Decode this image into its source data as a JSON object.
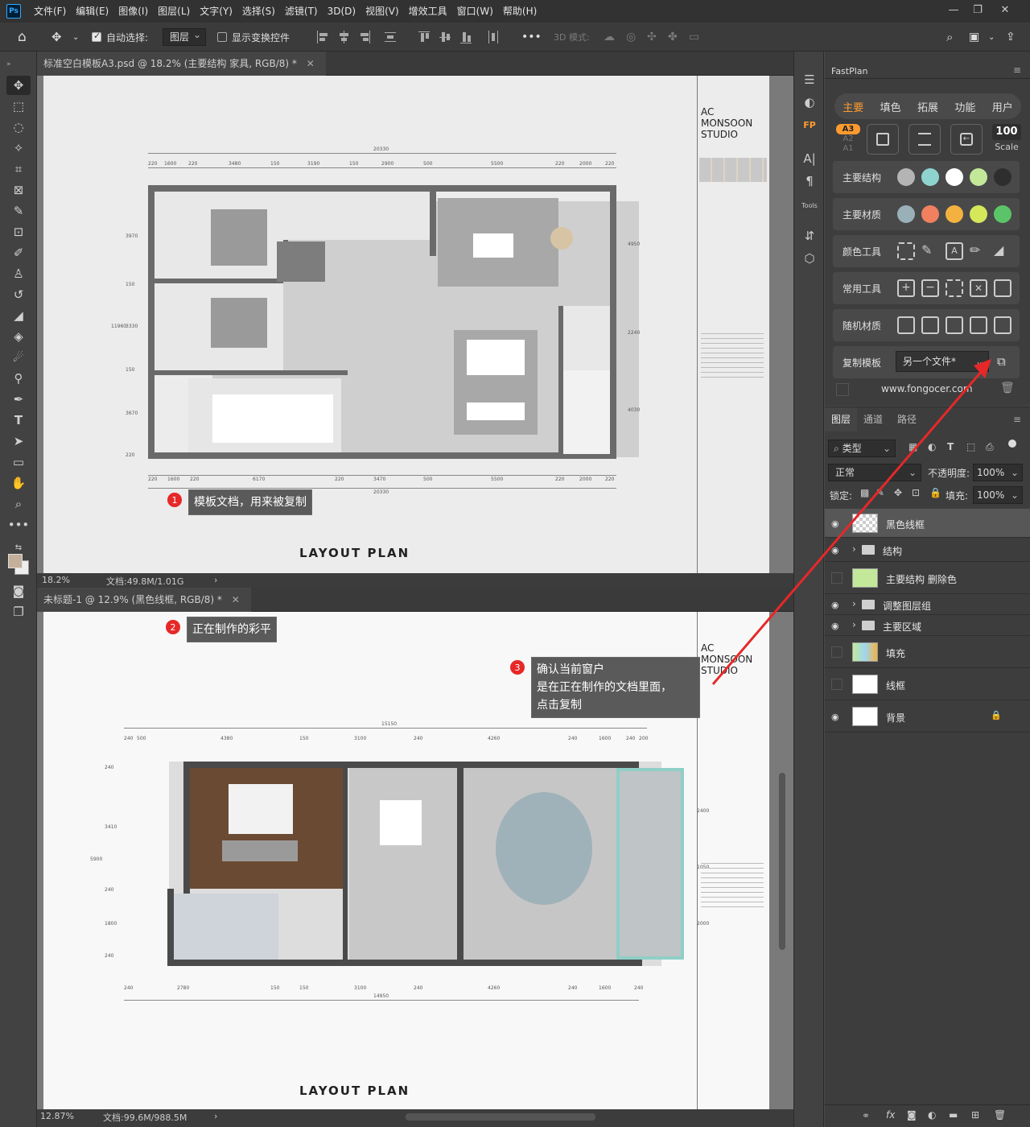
{
  "menubar": {
    "logo": "Ps",
    "items": [
      "文件(F)",
      "编辑(E)",
      "图像(I)",
      "图层(L)",
      "文字(Y)",
      "选择(S)",
      "滤镜(T)",
      "3D(D)",
      "视图(V)",
      "增效工具",
      "窗口(W)",
      "帮助(H)"
    ]
  },
  "options": {
    "auto_select_label": "自动选择:",
    "auto_select_value": "图层",
    "show_transform_label": "显示变换控件",
    "mode_3d_label": "3D 模式:",
    "more": "•••"
  },
  "doc1": {
    "tab_title": "标准空白模板A3.psd @ 18.2% (主要结构 家具, RGB/8) *",
    "zoom": "18.2%",
    "doc_size": "文档:49.8M/1.01G",
    "studio_name": [
      "AC",
      "MONSOON",
      "STUDIO"
    ],
    "layout_title": "LAYOUT PLAN",
    "dims_top_total": "20330",
    "dims_top": [
      "220",
      "1600",
      "220",
      "3480",
      "150",
      "3190",
      "150",
      "2900",
      "500",
      "5500",
      "220",
      "2000",
      "220"
    ],
    "dims_bottom": [
      "220",
      "1600",
      "220",
      "6170",
      "220",
      "3470",
      "500",
      "5500",
      "220",
      "2000",
      "220"
    ],
    "dims_bottom_total": "20330",
    "dims_left": [
      "3970",
      "150",
      "3330",
      "150",
      "3670",
      "220"
    ],
    "dims_left_total": "11960",
    "dims_right": [
      "4950",
      "2240",
      "4030"
    ]
  },
  "doc2": {
    "tab_title": "未标题-1 @ 12.9% (黑色线框, RGB/8) *",
    "zoom": "12.87%",
    "doc_size": "文档:99.6M/988.5M",
    "studio_name": [
      "AC",
      "MONSOON",
      "STUDIO"
    ],
    "layout_title": "LAYOUT PLAN",
    "dims_top_total": "15150",
    "dims_top": [
      "240",
      "500",
      "4380",
      "150",
      "3100",
      "240",
      "4260",
      "240",
      "1600",
      "240",
      "200"
    ],
    "dims_bottom": [
      "240",
      "2780",
      "150",
      "150",
      "3100",
      "240",
      "4260",
      "240",
      "1600",
      "240"
    ],
    "dims_bottom_total": "14950",
    "dims_left": [
      "240",
      "3410",
      "240",
      "1800",
      "240"
    ],
    "dims_left_total": "5900",
    "dims_right": [
      "2400",
      "1050",
      "2000"
    ]
  },
  "callouts": [
    {
      "num": "1",
      "text": "模板文档，用来被复制"
    },
    {
      "num": "2",
      "text": "正在制作的彩平"
    },
    {
      "num": "3",
      "lines": [
        "确认当前窗户",
        "是在正在制作的文档里面，",
        "点击复制"
      ]
    }
  ],
  "fastplan": {
    "title": "FastPlan",
    "tabs": [
      "主要",
      "填色",
      "拓展",
      "功能",
      "用户"
    ],
    "paper_sizes": [
      "A3",
      "A2",
      "A1"
    ],
    "scale_value": "100",
    "scale_label": "Scale",
    "rows": [
      {
        "label": "主要结构",
        "colors": [
          "#b4b4b4",
          "#8fd3cf",
          "#ffffff",
          "#c3e89a",
          "#2e2e2e"
        ]
      },
      {
        "label": "主要材质",
        "colors": [
          "#9ab0b8",
          "#f08060",
          "#f3b23f",
          "#d5e85a",
          "#5cc468"
        ]
      },
      {
        "label": "颜色工具"
      },
      {
        "label": "常用工具"
      },
      {
        "label": "随机材质"
      }
    ],
    "copy_template_label": "复制模板",
    "copy_template_value": "另一个文件*",
    "website": "www.fongocer.com"
  },
  "layers": {
    "tabs": [
      "图层",
      "通道",
      "路径"
    ],
    "filter_label": "类型",
    "blend_mode": "正常",
    "opacity_label": "不透明度:",
    "opacity_value": "100%",
    "lock_label": "锁定:",
    "fill_label": "填充:",
    "fill_value": "100%",
    "items": [
      {
        "name": "黑色线框",
        "type": "layer"
      },
      {
        "name": "结构",
        "type": "group"
      },
      {
        "name": "主要结构 删除色",
        "type": "layer"
      },
      {
        "name": "调整图层组",
        "type": "group"
      },
      {
        "name": "主要区域",
        "type": "group"
      },
      {
        "name": "填充",
        "type": "layer"
      },
      {
        "name": "线框",
        "type": "layer"
      },
      {
        "name": "背景",
        "type": "layer"
      }
    ]
  }
}
